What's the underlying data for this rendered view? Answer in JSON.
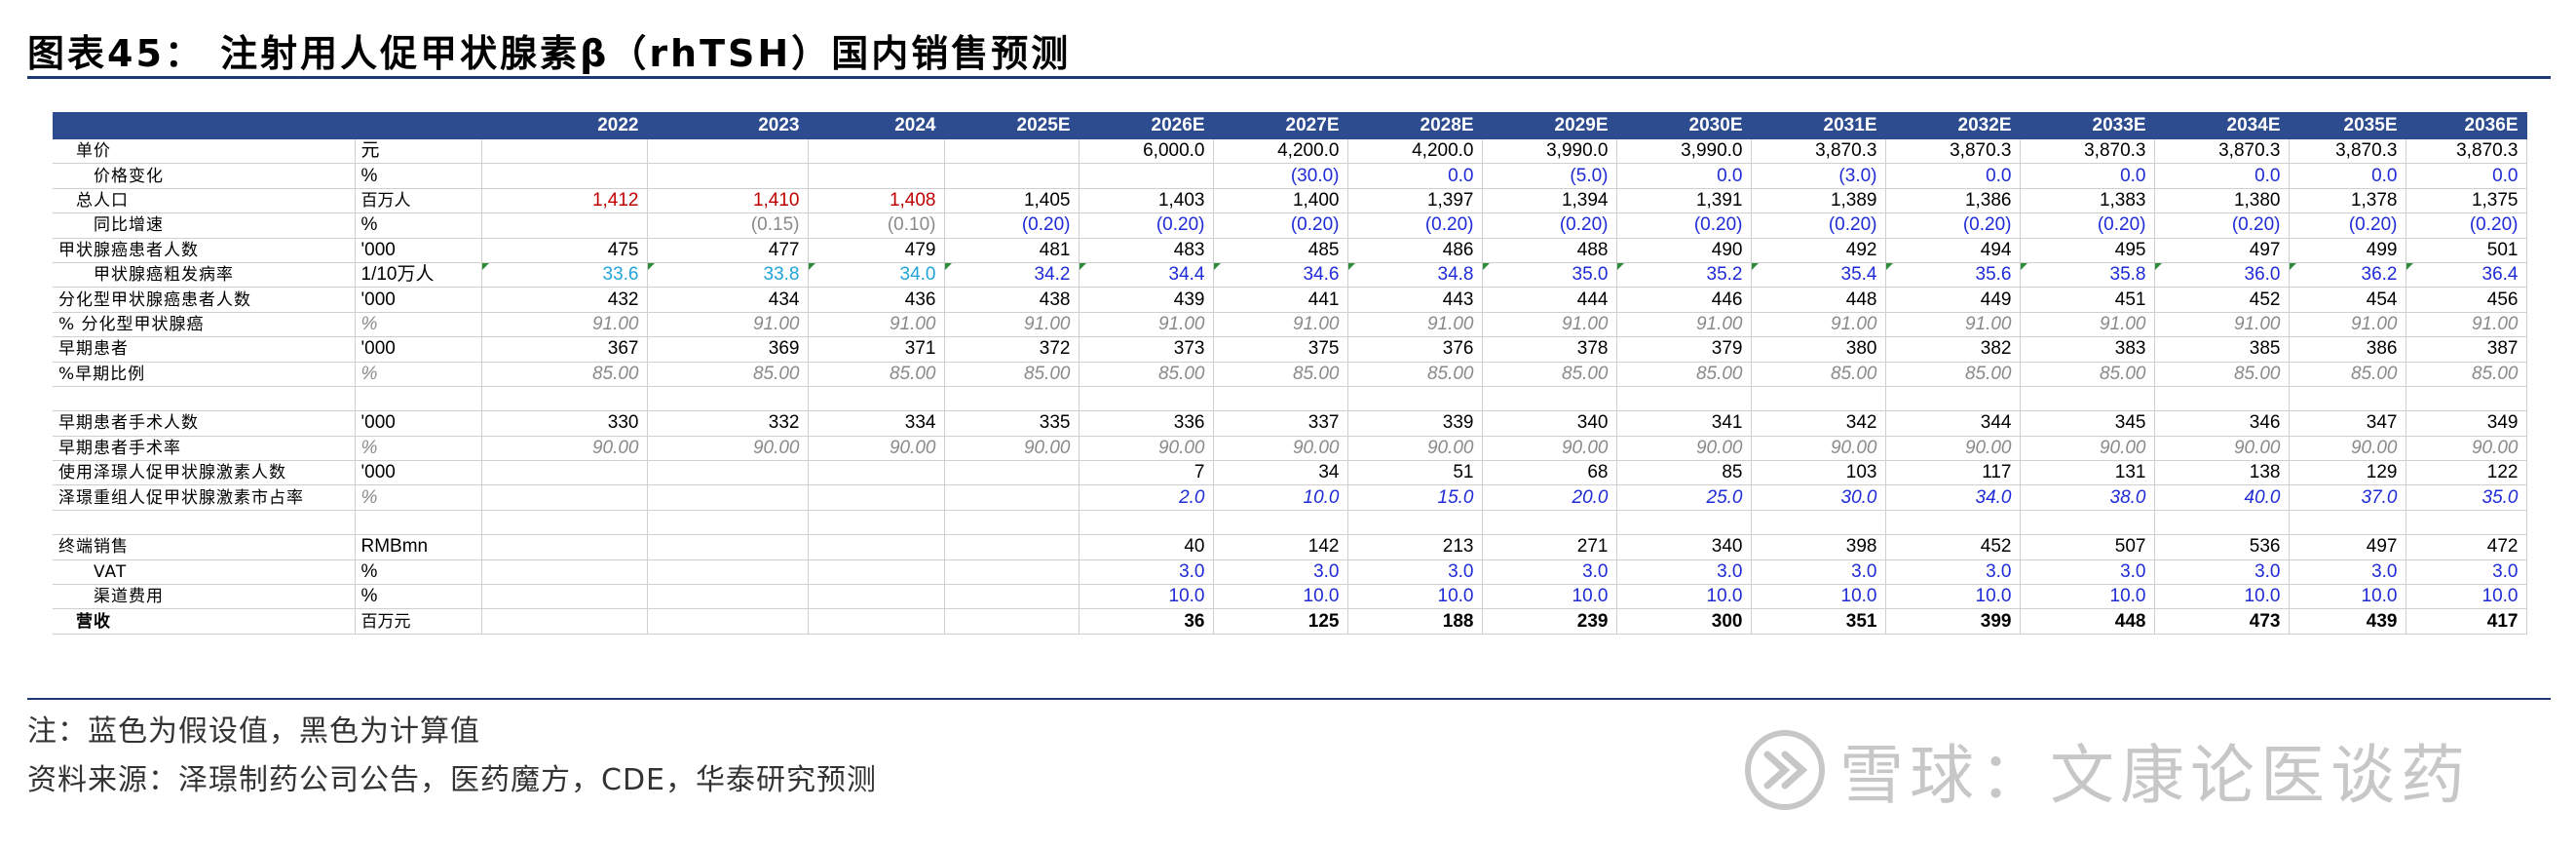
{
  "title": "图表45：  注射用人促甲状腺素β（rhTSH）国内销售预测",
  "columns": [
    "2022",
    "2023",
    "2024",
    "2025E",
    "2026E",
    "2027E",
    "2028E",
    "2029E",
    "2030E",
    "2031E",
    "2032E",
    "2033E",
    "2034E",
    "2035E",
    "2036E"
  ],
  "rows": [
    {
      "label": "单价",
      "indent": 1,
      "unit": "元",
      "style": "black",
      "values": [
        "",
        "",
        "",
        "",
        "6,000.0",
        "4,200.0",
        "4,200.0",
        "3,990.0",
        "3,990.0",
        "3,870.3",
        "3,870.3",
        "3,870.3",
        "3,870.3",
        "3,870.3",
        "3,870.3"
      ]
    },
    {
      "label": "价格变化",
      "indent": 2,
      "unit": "%",
      "style": "blue",
      "values": [
        "",
        "",
        "",
        "",
        "",
        "(30.0)",
        "0.0",
        "(5.0)",
        "0.0",
        "(3.0)",
        "0.0",
        "0.0",
        "0.0",
        "0.0",
        "0.0"
      ]
    },
    {
      "label": "总人口",
      "indent": 1,
      "unit": "百万人",
      "style": "black",
      "values": [
        "1,412",
        "1,410",
        "1,408",
        "1,405",
        "1,403",
        "1,400",
        "1,397",
        "1,394",
        "1,391",
        "1,389",
        "1,386",
        "1,383",
        "1,380",
        "1,378",
        "1,375"
      ],
      "red_first": 3
    },
    {
      "label": "同比增速",
      "indent": 2,
      "unit": "%",
      "style": "blue",
      "values": [
        "",
        "(0.15)",
        "(0.10)",
        "(0.20)",
        "(0.20)",
        "(0.20)",
        "(0.20)",
        "(0.20)",
        "(0.20)",
        "(0.20)",
        "(0.20)",
        "(0.20)",
        "(0.20)",
        "(0.20)",
        "(0.20)"
      ],
      "gray_first": 3
    },
    {
      "label": "甲状腺癌患者人数",
      "indent": 0,
      "unit": "'000",
      "style": "black",
      "values": [
        "475",
        "477",
        "479",
        "481",
        "483",
        "485",
        "486",
        "488",
        "490",
        "492",
        "494",
        "495",
        "497",
        "499",
        "501"
      ]
    },
    {
      "label": "甲状腺癌粗发病率",
      "indent": 2,
      "unit": "1/10万人",
      "style": "blue",
      "values": [
        "33.6",
        "33.8",
        "34.0",
        "34.2",
        "34.4",
        "34.6",
        "34.8",
        "35.0",
        "35.2",
        "35.4",
        "35.6",
        "35.8",
        "36.0",
        "36.2",
        "36.4"
      ],
      "cyan_first": 3,
      "flags": true
    },
    {
      "label": "分化型甲状腺癌患者人数",
      "indent": 0,
      "unit": "'000",
      "style": "black",
      "values": [
        "432",
        "434",
        "436",
        "438",
        "439",
        "441",
        "443",
        "444",
        "446",
        "448",
        "449",
        "451",
        "452",
        "454",
        "456"
      ]
    },
    {
      "label": "% 分化型甲状腺癌",
      "indent": 0,
      "unit": "%",
      "style": "grayital",
      "values": [
        "91.00",
        "91.00",
        "91.00",
        "91.00",
        "91.00",
        "91.00",
        "91.00",
        "91.00",
        "91.00",
        "91.00",
        "91.00",
        "91.00",
        "91.00",
        "91.00",
        "91.00"
      ]
    },
    {
      "label": "早期患者",
      "indent": 0,
      "unit": "'000",
      "style": "black",
      "values": [
        "367",
        "369",
        "371",
        "372",
        "373",
        "375",
        "376",
        "378",
        "379",
        "380",
        "382",
        "383",
        "385",
        "386",
        "387"
      ]
    },
    {
      "label": "%早期比例",
      "indent": 0,
      "unit": "%",
      "style": "grayital",
      "values": [
        "85.00",
        "85.00",
        "85.00",
        "85.00",
        "85.00",
        "85.00",
        "85.00",
        "85.00",
        "85.00",
        "85.00",
        "85.00",
        "85.00",
        "85.00",
        "85.00",
        "85.00"
      ]
    },
    {
      "label": "",
      "indent": 0,
      "unit": "",
      "style": "black",
      "values": [
        "",
        "",
        "",
        "",
        "",
        "",
        "",
        "",
        "",
        "",
        "",
        "",
        "",
        "",
        ""
      ]
    },
    {
      "label": "早期患者手术人数",
      "indent": 0,
      "unit": "'000",
      "style": "black",
      "values": [
        "330",
        "332",
        "334",
        "335",
        "336",
        "337",
        "339",
        "340",
        "341",
        "342",
        "344",
        "345",
        "346",
        "347",
        "349"
      ]
    },
    {
      "label": "早期患者手术率",
      "indent": 0,
      "unit": "%",
      "style": "grayital",
      "values": [
        "90.00",
        "90.00",
        "90.00",
        "90.00",
        "90.00",
        "90.00",
        "90.00",
        "90.00",
        "90.00",
        "90.00",
        "90.00",
        "90.00",
        "90.00",
        "90.00",
        "90.00"
      ]
    },
    {
      "label": "使用泽璟人促甲状腺激素人数",
      "indent": 0,
      "unit": "'000",
      "style": "black",
      "values": [
        "",
        "",
        "",
        "",
        "7",
        "34",
        "51",
        "68",
        "85",
        "103",
        "117",
        "131",
        "138",
        "129",
        "122"
      ]
    },
    {
      "label": "泽璟重组人促甲状腺激素市占率",
      "indent": 0,
      "unit": "%",
      "style": "blueital",
      "unit_style": "grayital",
      "values": [
        "",
        "",
        "",
        "",
        "2.0",
        "10.0",
        "15.0",
        "20.0",
        "25.0",
        "30.0",
        "34.0",
        "38.0",
        "40.0",
        "37.0",
        "35.0"
      ]
    },
    {
      "label": "",
      "indent": 0,
      "unit": "",
      "style": "black",
      "values": [
        "",
        "",
        "",
        "",
        "",
        "",
        "",
        "",
        "",
        "",
        "",
        "",
        "",
        "",
        ""
      ]
    },
    {
      "label": "终端销售",
      "indent": 0,
      "unit": "RMBmn",
      "style": "black",
      "values": [
        "",
        "",
        "",
        "",
        "40",
        "142",
        "213",
        "271",
        "340",
        "398",
        "452",
        "507",
        "536",
        "497",
        "472"
      ]
    },
    {
      "label": "VAT",
      "indent": 2,
      "unit": "%",
      "style": "blue",
      "values": [
        "",
        "",
        "",
        "",
        "3.0",
        "3.0",
        "3.0",
        "3.0",
        "3.0",
        "3.0",
        "3.0",
        "3.0",
        "3.0",
        "3.0",
        "3.0"
      ]
    },
    {
      "label": "渠道费用",
      "indent": 2,
      "unit": "%",
      "style": "blue",
      "values": [
        "",
        "",
        "",
        "",
        "10.0",
        "10.0",
        "10.0",
        "10.0",
        "10.0",
        "10.0",
        "10.0",
        "10.0",
        "10.0",
        "10.0",
        "10.0"
      ]
    },
    {
      "label": "营收",
      "indent": 1,
      "unit": "百万元",
      "style": "bold",
      "values": [
        "",
        "",
        "",
        "",
        "36",
        "125",
        "188",
        "239",
        "300",
        "351",
        "399",
        "448",
        "473",
        "439",
        "417"
      ]
    }
  ],
  "notes": {
    "line1": "注：蓝色为假设值，黑色为计算值",
    "line2": "资料来源：泽璟制药公司公告，医药魔方，CDE，华泰研究预测"
  },
  "watermark": {
    "text": "雪球：文康论医谈药",
    "icon": "snowball-logo-icon"
  }
}
